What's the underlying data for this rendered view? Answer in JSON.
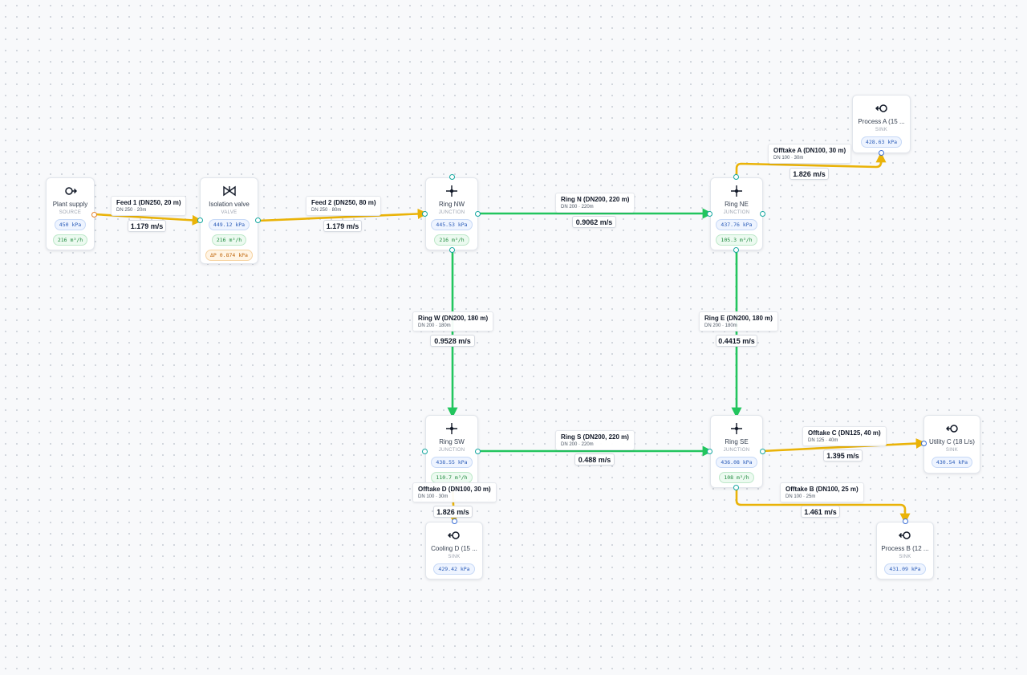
{
  "colors": {
    "flow_green": "#22c55e",
    "flow_amber": "#eab308",
    "handle_teal": "#17a8a0",
    "handle_orange": "#e4822a",
    "handle_blue": "#3b6fd6"
  },
  "nodes": {
    "plant_supply": {
      "icon": "source-icon",
      "name": "Plant supply",
      "type": "SOURCE",
      "pressure": "450 kPa",
      "flow": "216 m³/h"
    },
    "isolation_valve": {
      "icon": "valve-icon",
      "name": "Isolation valve",
      "type": "VALVE",
      "pressure": "449.12 kPa",
      "flow": "216 m³/h",
      "dp": "ΔP 0.874 kPa"
    },
    "ring_nw": {
      "icon": "junction-icon",
      "name": "Ring NW",
      "type": "JUNCTION",
      "pressure": "445.53 kPa",
      "flow": "216 m³/h"
    },
    "ring_ne": {
      "icon": "junction-icon",
      "name": "Ring NE",
      "type": "JUNCTION",
      "pressure": "437.76 kPa",
      "flow": "105.3 m³/h"
    },
    "ring_sw": {
      "icon": "junction-icon",
      "name": "Ring SW",
      "type": "JUNCTION",
      "pressure": "438.55 kPa",
      "flow": "110.7 m³/h"
    },
    "ring_se": {
      "icon": "junction-icon",
      "name": "Ring SE",
      "type": "JUNCTION",
      "pressure": "436.08 kPa",
      "flow": "108 m³/h"
    },
    "process_a": {
      "icon": "sink-icon",
      "name": "Process A (15 ...",
      "type": "SINK",
      "pressure": "428.63 kPa"
    },
    "utility_c": {
      "icon": "sink-icon",
      "name": "Utility C (18 L/s)",
      "type": "SINK",
      "pressure": "430.54 kPa"
    },
    "process_b": {
      "icon": "sink-icon",
      "name": "Process B (12 ...",
      "type": "SINK",
      "pressure": "431.09 kPa"
    },
    "cooling_d": {
      "icon": "sink-icon",
      "name": "Cooling D (15 ...",
      "type": "SINK",
      "pressure": "429.42 kPa"
    }
  },
  "edges": {
    "feed1": {
      "title": "Feed 1 (DN250, 20 m)",
      "spec": "DN 250 · 20m",
      "velocity": "1.179 m/s"
    },
    "feed2": {
      "title": "Feed 2 (DN250, 80 m)",
      "spec": "DN 250 · 80m",
      "velocity": "1.179 m/s"
    },
    "ring_n": {
      "title": "Ring N (DN200, 220 m)",
      "spec": "DN 200 · 220m",
      "velocity": "0.9062 m/s"
    },
    "ring_w": {
      "title": "Ring W (DN200, 180 m)",
      "spec": "DN 200 · 180m",
      "velocity": "0.9528 m/s"
    },
    "ring_e": {
      "title": "Ring E (DN200, 180 m)",
      "spec": "DN 200 · 180m",
      "velocity": "0.4415 m/s"
    },
    "ring_s": {
      "title": "Ring S (DN200, 220 m)",
      "spec": "DN 200 · 220m",
      "velocity": "0.488 m/s"
    },
    "offtake_a": {
      "title": "Offtake A (DN100, 30 m)",
      "spec": "DN 100 · 30m",
      "velocity": "1.826 m/s"
    },
    "offtake_c": {
      "title": "Offtake C (DN125, 40 m)",
      "spec": "DN 125 · 40m",
      "velocity": "1.395 m/s"
    },
    "offtake_b": {
      "title": "Offtake B (DN100, 25 m)",
      "spec": "DN 100 · 25m",
      "velocity": "1.461 m/s"
    },
    "offtake_d": {
      "title": "Offtake D (DN100, 30 m)",
      "spec": "DN 100 · 30m",
      "velocity": "1.826 m/s"
    }
  }
}
